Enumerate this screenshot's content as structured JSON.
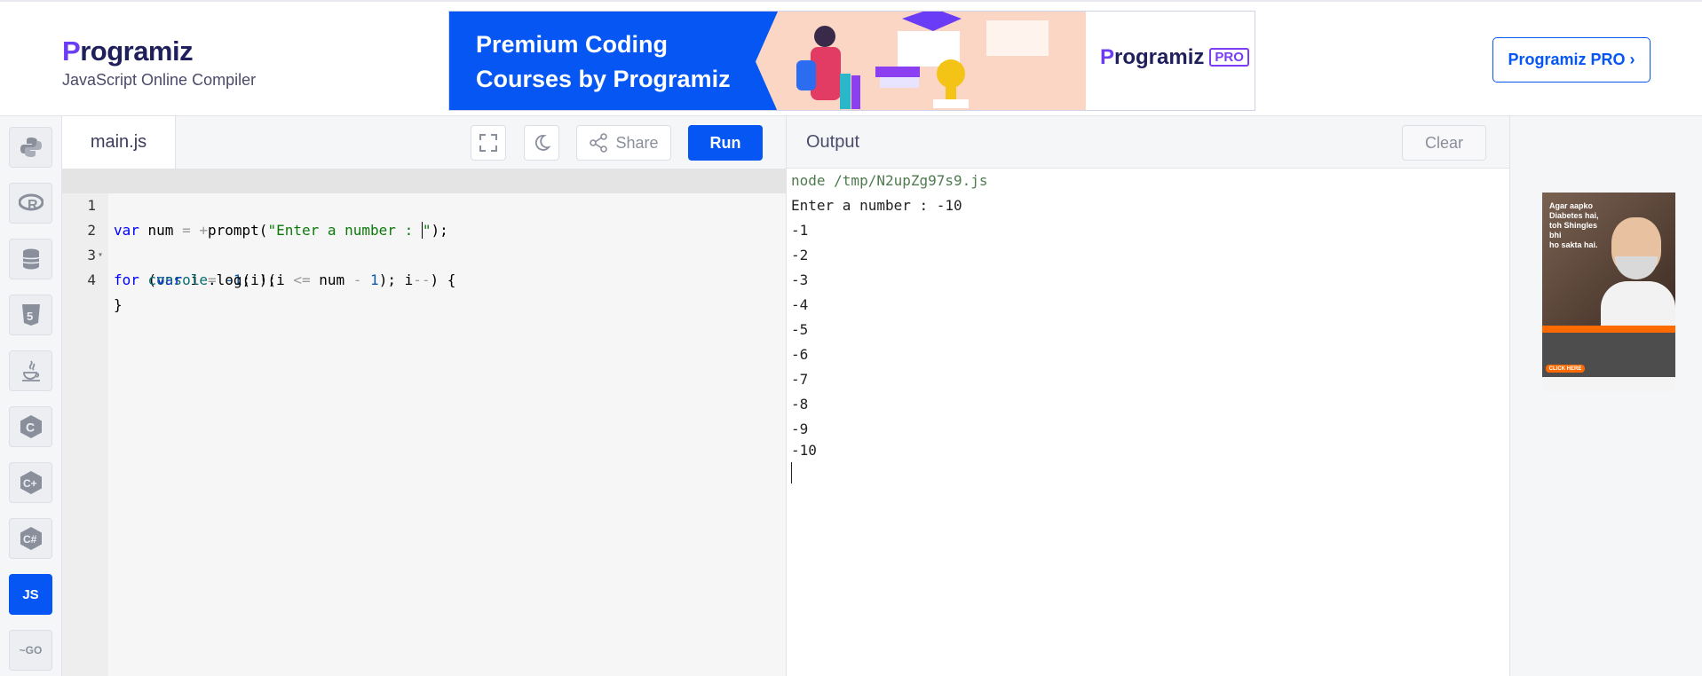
{
  "header": {
    "logo": "Programiz",
    "subtitle": "JavaScript Online Compiler",
    "banner": {
      "headline": "Premium Coding\nCourses by Programiz",
      "pro_logo": "Programiz",
      "pro_tag": "PRO"
    },
    "pro_button": "Programiz PRO ›"
  },
  "sidebar": {
    "languages": [
      {
        "name": "python",
        "label": "🐍",
        "active": false
      },
      {
        "name": "r",
        "label": "R",
        "active": false
      },
      {
        "name": "sql",
        "label": "≡",
        "active": false
      },
      {
        "name": "html",
        "label": "5",
        "active": false
      },
      {
        "name": "java",
        "label": "☕",
        "active": false
      },
      {
        "name": "c",
        "label": "C",
        "active": false
      },
      {
        "name": "cpp",
        "label": "C+",
        "active": false
      },
      {
        "name": "csharp",
        "label": "C#",
        "active": false
      },
      {
        "name": "js",
        "label": "JS",
        "active": true
      },
      {
        "name": "go",
        "label": "GO",
        "active": false
      }
    ]
  },
  "editor": {
    "filename": "main.js",
    "share_label": "Share",
    "run_label": "Run",
    "lines": [
      {
        "n": "1",
        "code": "var num = +prompt(\"Enter a number : \");"
      },
      {
        "n": "2",
        "code": "for (var i = -1; !(i <= num - 1); i--) {"
      },
      {
        "n": "3",
        "code": "    console.log(i);"
      },
      {
        "n": "4",
        "code": "}"
      }
    ]
  },
  "output": {
    "title": "Output",
    "clear_label": "Clear",
    "command": "node /tmp/N2upZg97s9.js",
    "lines": [
      "Enter a number : -10",
      "-1",
      "-2",
      "-3",
      "-4",
      "-5",
      "-6",
      "-7",
      "-8",
      "-9",
      "-10"
    ]
  },
  "ad": {
    "headline": "Agar aapko\nDiabetes hai,\ntoh Shingles bhi\nho sakta hai.",
    "cta": "CLICK HERE"
  }
}
